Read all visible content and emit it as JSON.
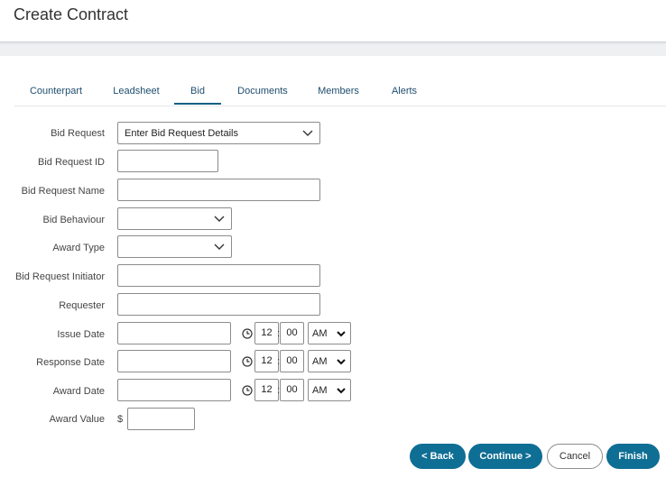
{
  "header": {
    "title": "Create Contract"
  },
  "tabs": [
    {
      "label": "Counterpart"
    },
    {
      "label": "Leadsheet"
    },
    {
      "label": "Bid"
    },
    {
      "label": "Documents"
    },
    {
      "label": "Members"
    },
    {
      "label": "Alerts"
    }
  ],
  "active_tab": "Bid",
  "form": {
    "bid_request": {
      "label": "Bid Request",
      "value": "Enter Bid Request Details"
    },
    "bid_request_id": {
      "label": "Bid Request ID",
      "value": ""
    },
    "bid_request_name": {
      "label": "Bid Request Name",
      "value": ""
    },
    "bid_behaviour": {
      "label": "Bid Behaviour",
      "value": ""
    },
    "award_type": {
      "label": "Award Type",
      "value": ""
    },
    "bid_request_initiator": {
      "label": "Bid Request Initiator",
      "value": ""
    },
    "requester": {
      "label": "Requester",
      "value": ""
    },
    "issue_date": {
      "label": "Issue Date",
      "value": "",
      "hour": "12",
      "minute": "00",
      "ampm": "AM"
    },
    "response_date": {
      "label": "Response Date",
      "value": "",
      "hour": "12",
      "minute": "00",
      "ampm": "AM"
    },
    "award_date": {
      "label": "Award Date",
      "value": "",
      "hour": "12",
      "minute": "00",
      "ampm": "AM"
    },
    "award_value": {
      "label": "Award Value",
      "currency": "$",
      "value": ""
    }
  },
  "buttons": {
    "back": "< Back",
    "continue": "Continue >",
    "cancel": "Cancel",
    "finish": "Finish"
  },
  "colors": {
    "primary": "#0f6e94",
    "tab_text": "#1f4e6e"
  }
}
